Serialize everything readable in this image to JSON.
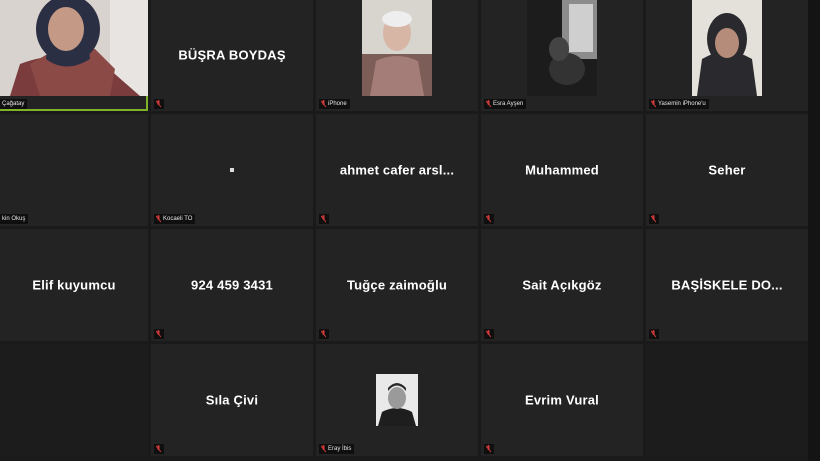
{
  "participants": [
    {
      "name": "",
      "label": "Çağatay",
      "video": "woman-hijab",
      "active": true
    },
    {
      "name": "BÜŞRA BOYDAŞ",
      "label": "",
      "video": null
    },
    {
      "name": "",
      "label": "iPhone",
      "video": "older-man"
    },
    {
      "name": "",
      "label": "Esra Ayşen",
      "video": "dark-room"
    },
    {
      "name": "",
      "label": "Yasemin iPhone'u",
      "video": "woman-scarf"
    },
    {
      "name": "",
      "label": "kin Okuş",
      "video": null
    },
    {
      "name": "",
      "label": "Kocaeli TO",
      "video": null,
      "dot": true
    },
    {
      "name": "ahmet cafer arsl...",
      "label": "",
      "video": null
    },
    {
      "name": "Muhammed",
      "label": "",
      "video": null
    },
    {
      "name": "Seher",
      "label": "",
      "video": null
    },
    {
      "name": "Elif kuyumcu",
      "label": "",
      "video": null
    },
    {
      "name": "924 459 3431",
      "label": "",
      "video": null
    },
    {
      "name": "Tuğçe zaimoğlu",
      "label": "",
      "video": null
    },
    {
      "name": "Sait Açıkgöz",
      "label": "",
      "video": null
    },
    {
      "name": "BAŞİSKELE DO...",
      "label": "",
      "video": null
    },
    {
      "name": "",
      "label": "",
      "video": null,
      "empty": true
    },
    {
      "name": "Sıla Çivi",
      "label": "",
      "video": null
    },
    {
      "name": "",
      "label": "Eray İbis",
      "video": "profile-photo"
    },
    {
      "name": "Evrim Vural",
      "label": "",
      "video": null
    },
    {
      "name": "",
      "label": "",
      "video": null,
      "empty": true
    }
  ],
  "colors": {
    "active_border": "#7fb32a",
    "mic_muted": "#d33b3b"
  }
}
